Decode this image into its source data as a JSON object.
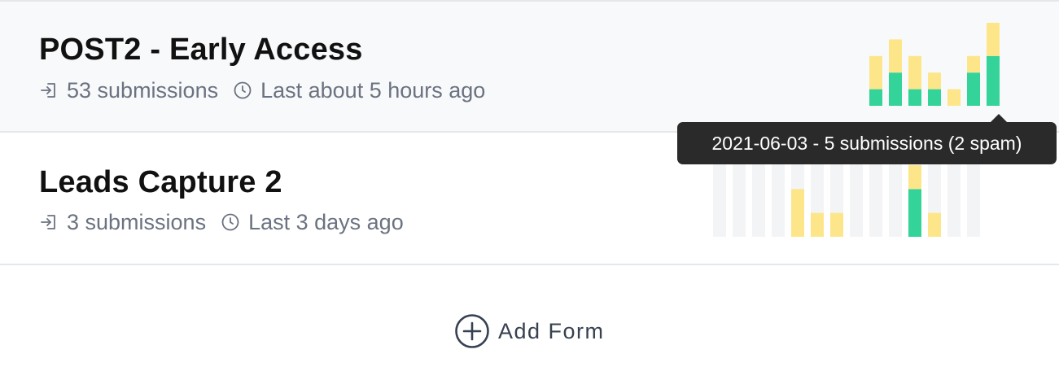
{
  "forms": [
    {
      "title": "POST2 - Early Access",
      "submissions": "53 submissions",
      "last": "Last about 5 hours ago",
      "chart": {
        "valid": [
          1,
          2,
          1,
          1,
          0,
          2,
          3
        ],
        "spam": [
          2,
          2,
          2,
          1,
          1,
          1,
          2
        ],
        "show_placeholders": false
      }
    },
    {
      "title": "Leads Capture 2",
      "submissions": "3 submissions",
      "last": "Last 3 days ago",
      "chart": {
        "valid": [
          0,
          0,
          0,
          0,
          0,
          0,
          0,
          0,
          0,
          0,
          2,
          0,
          0,
          0
        ],
        "spam": [
          0,
          0,
          0,
          0,
          2,
          1,
          1,
          0,
          0,
          0,
          1,
          1,
          0,
          0
        ],
        "show_placeholders": true
      }
    }
  ],
  "tooltip": {
    "text": "2021-06-03 - 5 submissions (2 spam)"
  },
  "add_form": {
    "label": "Add Form"
  },
  "colors": {
    "valid": "#34d399",
    "spam": "#fde68a",
    "placeholder": "#f3f4f6",
    "tooltip_bg": "#2a2a2a"
  },
  "icons": {
    "submissions": "sign-in-icon",
    "last": "clock-icon",
    "add": "plus-circle-icon"
  }
}
